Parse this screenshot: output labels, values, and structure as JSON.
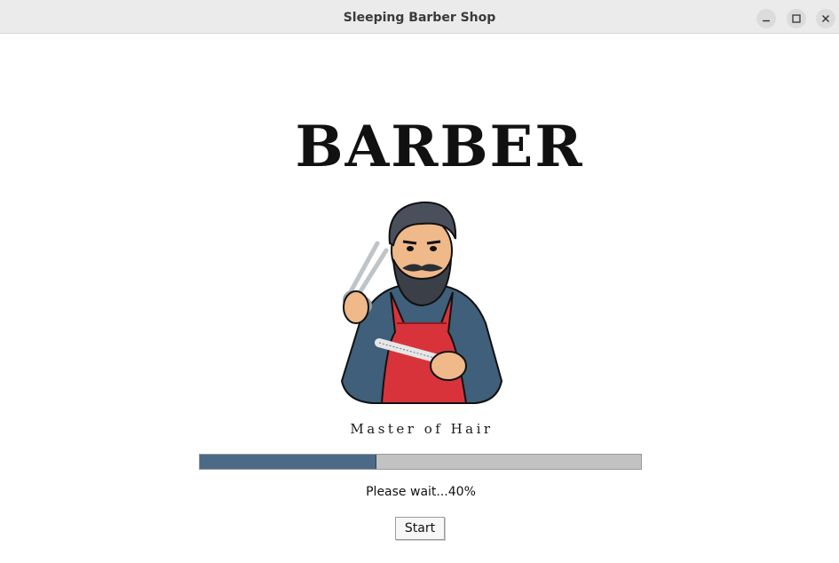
{
  "window": {
    "title": "Sleeping Barber Shop"
  },
  "splash": {
    "logo_text": "BARBER",
    "tagline": "Master of Hair"
  },
  "progress": {
    "value_percent": 40,
    "status_text": "Please wait...40%"
  },
  "actions": {
    "start_label": "Start"
  },
  "colors": {
    "titlebar_bg": "#ebebeb",
    "progress_fill": "#4b6a88",
    "progress_track": "#c2c2c2",
    "apron_red": "#d8333b",
    "shirt_blue": "#3f5f7a"
  },
  "icons": {
    "minimize": "minimize-icon",
    "maximize": "maximize-icon",
    "close": "close-icon"
  }
}
